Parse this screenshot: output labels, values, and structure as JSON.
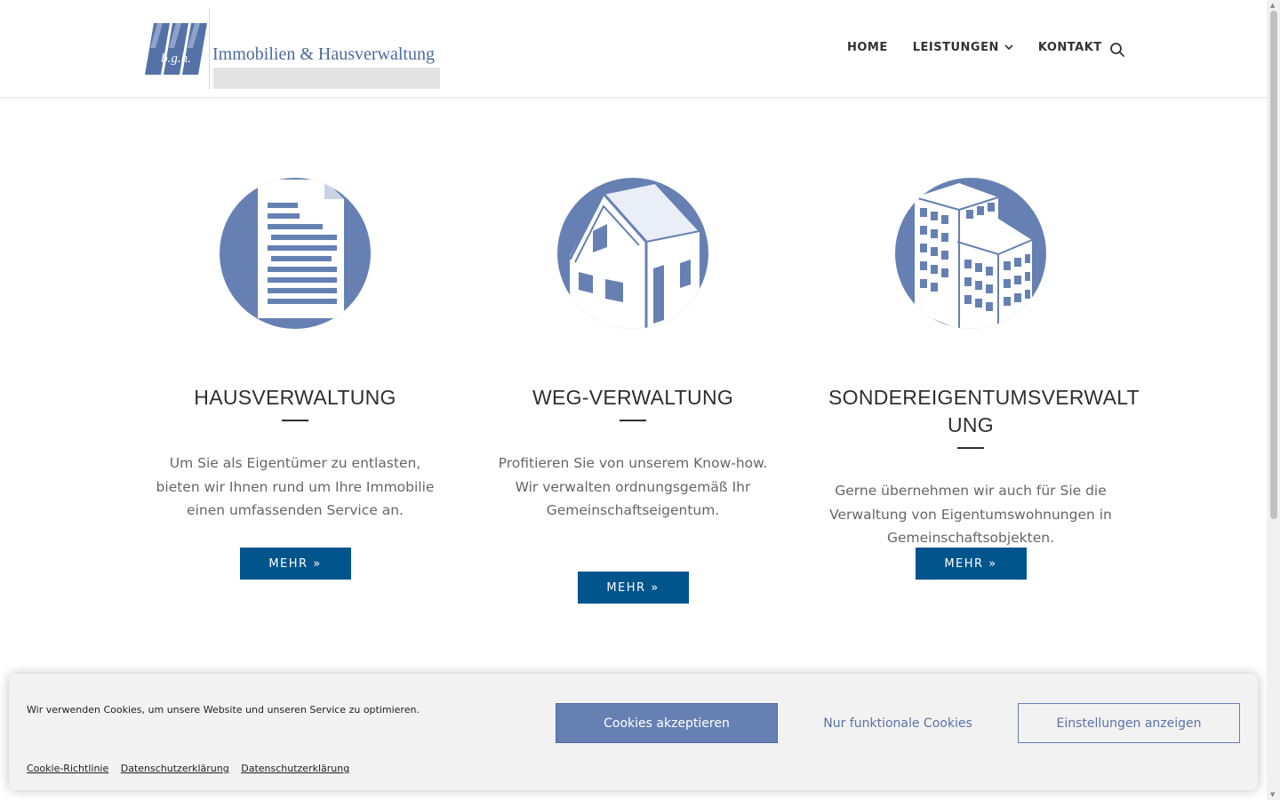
{
  "header": {
    "logo_text": "Immobilien & Hausverwaltung",
    "logo_mark_letters": "b.g.h.",
    "nav": [
      {
        "label": "HOME"
      },
      {
        "label": "LEISTUNGEN",
        "has_dropdown": true
      },
      {
        "label": "KONTAKT"
      }
    ]
  },
  "services": [
    {
      "title": "HAUSVERWALTUNG",
      "text": "Um Sie als Eigentümer zu entlasten, bieten wir Ihnen rund um Ihre Immobilie einen umfassenden Service an.",
      "button": "MEHR »",
      "icon": "document-icon"
    },
    {
      "title": "WEG-VERWALTUNG",
      "text": "Profitieren Sie von unserem Know-how. Wir verwalten ordnungsgemäß Ihr Gemeinschaftseigentum.",
      "button": "MEHR »",
      "icon": "house-icon"
    },
    {
      "title": "SONDEREIGENTUMSVERWALT UNG",
      "text": "Gerne übernehmen wir auch für Sie die Verwaltung von Eigentumswohnungen in Gemeinschaftsobjekten.",
      "button": "MEHR »",
      "icon": "building-icon"
    }
  ],
  "cookie": {
    "message": "Wir verwenden Cookies, um unsere Website und unseren Service zu optimieren.",
    "accept": "Cookies akzeptieren",
    "functional": "Nur funktionale Cookies",
    "settings": "Einstellungen anzeigen",
    "links": [
      "Cookie-Richtlinie",
      "Datenschutzerklärung",
      "Datenschutzerklärung"
    ]
  },
  "colors": {
    "accent": "#6680b3",
    "button": "#00558c",
    "text": "#666666",
    "heading": "#2f2f2f"
  }
}
